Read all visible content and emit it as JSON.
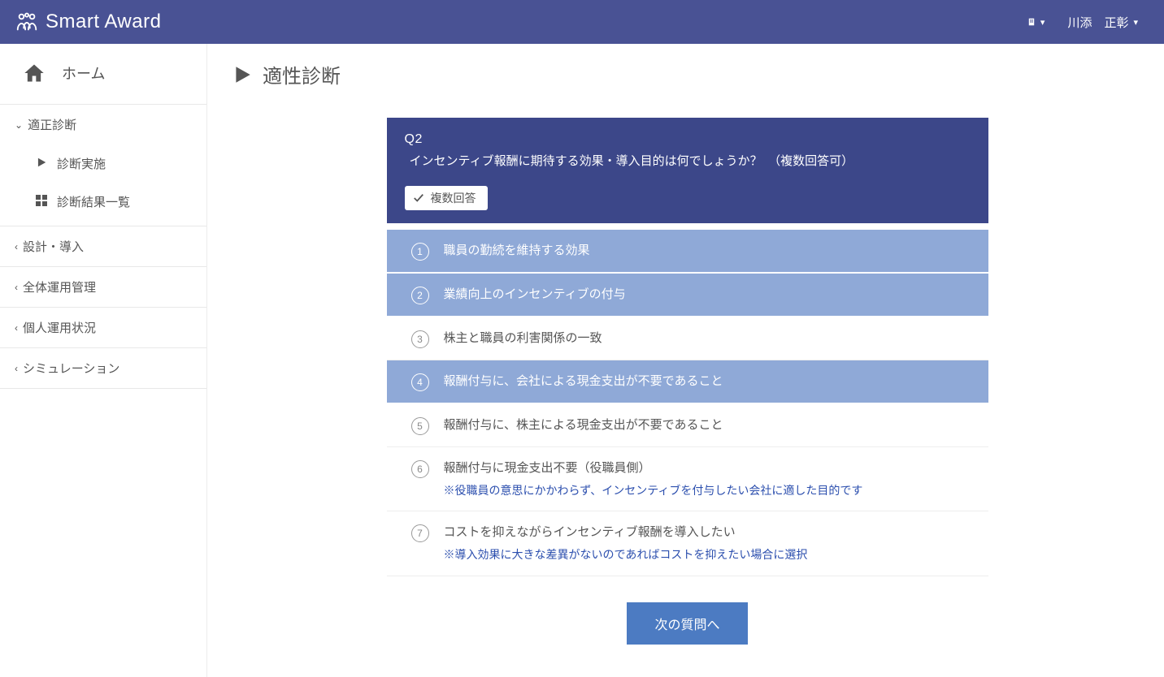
{
  "header": {
    "brand": "Smart Award",
    "building_label": "建",
    "user_name": "川添　正彰"
  },
  "sidebar": {
    "home": "ホーム",
    "categories": [
      {
        "label": "適正診断",
        "open": true,
        "items": [
          {
            "label": "診断実施",
            "icon": "play"
          },
          {
            "label": "診断結果一覧",
            "icon": "grid"
          }
        ]
      },
      {
        "label": "設計・導入"
      },
      {
        "label": "全体運用管理"
      },
      {
        "label": "個人運用状況"
      },
      {
        "label": "シミュレーション"
      }
    ]
  },
  "page": {
    "title": "適性診断"
  },
  "question": {
    "number": "Q2",
    "text": "インセンティブ報酬に期待する効果・導入目的は何でしょうか？　（複数回答可）",
    "badge": "複数回答",
    "answers": [
      {
        "label": "職員の勤続を維持する効果",
        "selected": true
      },
      {
        "label": "業績向上のインセンティブの付与",
        "selected": true
      },
      {
        "label": "株主と職員の利害関係の一致",
        "selected": false
      },
      {
        "label": "報酬付与に、会社による現金支出が不要であること",
        "selected": true
      },
      {
        "label": "報酬付与に、株主による現金支出が不要であること",
        "selected": false
      },
      {
        "label": "報酬付与に現金支出不要（役職員側）",
        "note": "※役職員の意思にかかわらず、インセンティブを付与したい会社に適した目的です",
        "selected": false
      },
      {
        "label": "コストを抑えながらインセンティブ報酬を導入したい",
        "note": "※導入効果に大きな差異がないのであればコストを抑えたい場合に選択",
        "selected": false
      }
    ],
    "next_button": "次の質問へ"
  }
}
